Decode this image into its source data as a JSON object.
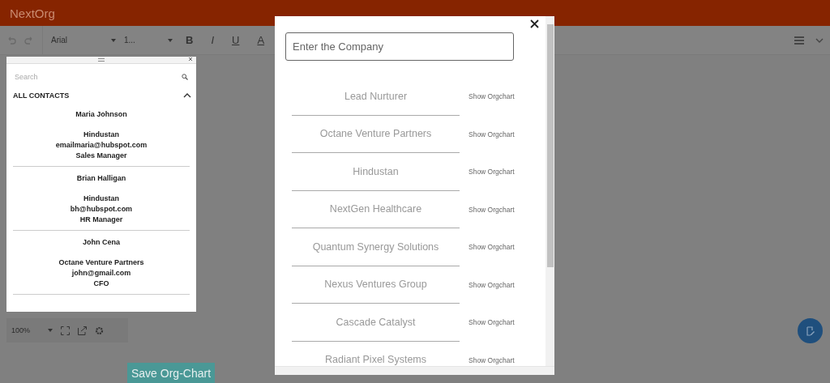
{
  "app": {
    "title": "NextOrg"
  },
  "toolbar": {
    "font": "Arial",
    "size": "1...",
    "format_buttons": [
      "B",
      "I",
      "U",
      "A"
    ]
  },
  "contacts_panel": {
    "search": {
      "placeholder": "Search"
    },
    "section": {
      "title": "ALL CONTACTS",
      "expanded": true
    },
    "contacts": [
      {
        "name": "Maria Johnson",
        "company": "Hindustan",
        "email": "emailmaria@hubspot.com",
        "role": "Sales Manager"
      },
      {
        "name": "Brian Halligan",
        "company": "Hindustan",
        "email": "bh@hubspot.com",
        "role": "HR Manager"
      },
      {
        "name": "John Cena",
        "company": "Octane Venture Partners",
        "email": "john@gmail.com",
        "role": "CFO"
      }
    ]
  },
  "zoom_bar": {
    "zoom": "100%"
  },
  "save_button": "Save Org-Chart",
  "modal": {
    "search": {
      "placeholder": "Enter the Company"
    },
    "companies": [
      {
        "name": "Lead Nurturer",
        "action": "Show Orgchart"
      },
      {
        "name": "Octane Venture Partners",
        "action": "Show Orgchart"
      },
      {
        "name": "Hindustan",
        "action": "Show Orgchart"
      },
      {
        "name": "NextGen Healthcare",
        "action": "Show Orgchart"
      },
      {
        "name": "Quantum Synergy Solutions",
        "action": "Show Orgchart"
      },
      {
        "name": "Nexus Ventures Group",
        "action": "Show Orgchart"
      },
      {
        "name": "Cascade Catalyst",
        "action": "Show Orgchart"
      },
      {
        "name": "Radiant Pixel Systems",
        "action": "Show Orgchart"
      }
    ]
  }
}
